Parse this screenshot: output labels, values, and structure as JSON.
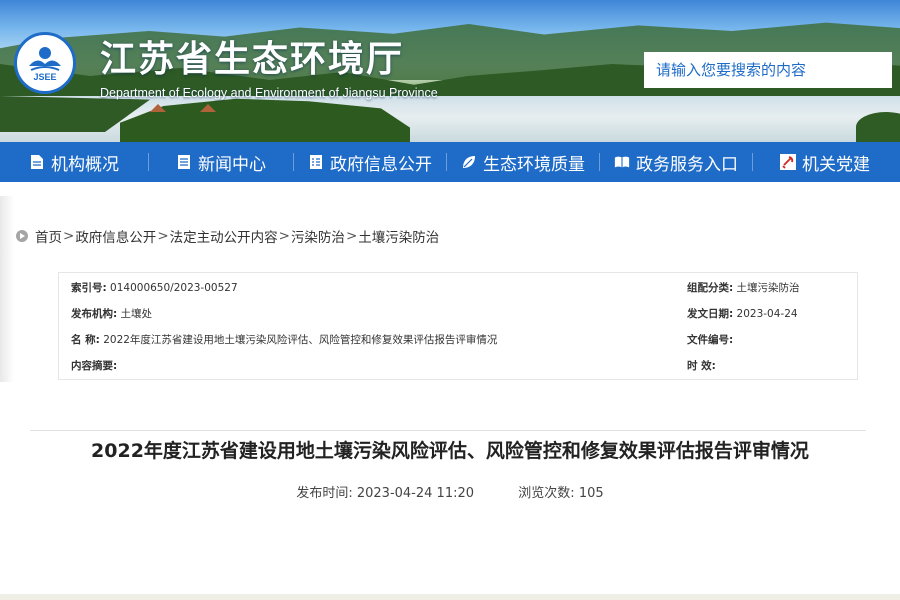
{
  "header": {
    "site_title": "江苏省生态环境厅",
    "site_subtitle": "Department of Ecology and Environment of Jiangsu Province",
    "logo_text": "JSEE",
    "search_placeholder": "请输入您要搜索的内容"
  },
  "nav": {
    "items": [
      {
        "label": "机构概况",
        "icon": "document-icon"
      },
      {
        "label": "新闻中心",
        "icon": "news-icon"
      },
      {
        "label": "政府信息公开",
        "icon": "info-list-icon"
      },
      {
        "label": "生态环境质量",
        "icon": "leaf-icon"
      },
      {
        "label": "政务服务入口",
        "icon": "book-icon"
      },
      {
        "label": "机关党建",
        "icon": "party-emblem-icon"
      }
    ]
  },
  "breadcrumb": {
    "items": [
      "首页",
      "政府信息公开",
      "法定主动公开内容",
      "污染防治",
      "土壤污染防治"
    ],
    "separator": ">"
  },
  "info": {
    "index_label": "索引号:",
    "index_value": "014000650/2023-00527",
    "category_label": "组配分类:",
    "category_value": "土壤污染防治",
    "publisher_label": "发布机构:",
    "publisher_value": "土壤处",
    "date_label": "发文日期:",
    "date_value": "2023-04-24",
    "name_label": "名 称:",
    "name_value": "2022年度江苏省建设用地土壤污染风险评估、风险管控和修复效果评估报告评审情况",
    "docno_label": "文件编号:",
    "docno_value": "",
    "summary_label": "内容摘要:",
    "summary_value": "",
    "validity_label": "时 效:",
    "validity_value": ""
  },
  "article": {
    "title": "2022年度江苏省建设用地土壤污染风险评估、风险管控和修复效果评估报告评审情况",
    "publish_time_label": "发布时间:",
    "publish_time": "2023-04-24 11:20",
    "views_label": "浏览次数:",
    "views": "105"
  },
  "colors": {
    "nav_bg": "#1e6bc8",
    "accent_blue": "#1e6cc8",
    "text": "#333333"
  }
}
